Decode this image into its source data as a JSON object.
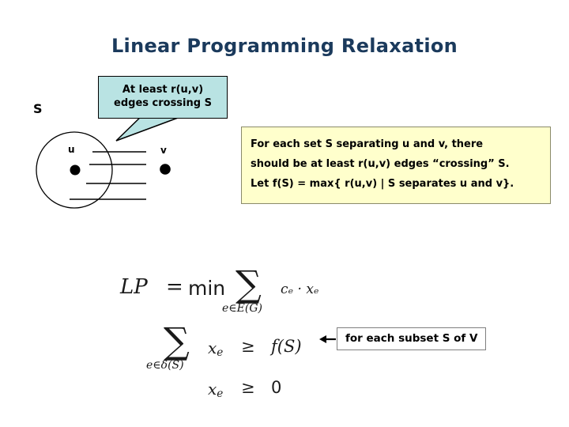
{
  "slide": {
    "title": "Linear Programming Relaxation",
    "title_color": "#1b3a5c",
    "background": "#ffffff"
  },
  "callout_cyan": {
    "fill": "#b9e3e3",
    "border": "#000000",
    "line1": "At least r(u,v)",
    "line2": "edges crossing S"
  },
  "diagram": {
    "set_label": "S",
    "vertex_u_label": "u",
    "vertex_v_label": "v",
    "crossing_edge_count": 4
  },
  "box_yellow": {
    "fill": "#ffffcc",
    "border": "#8a8a6a",
    "line1": "For each set S separating u and v, there",
    "line2": "should be at least r(u,v) edges “crossing” S.",
    "line3": "Let f(S) = max{ r(u,v) | S separates u and v}."
  },
  "lp": {
    "name": "LP",
    "equals": "=",
    "objective_op": "min",
    "sigma": "∑",
    "sum1_subscript": "e∈E(G)",
    "objective_terms": "cₑ · xₑ",
    "objective_c": "c",
    "objective_x": "x",
    "sub_e": "e",
    "dot": "·",
    "sum2_subscript": "e∈δ(S)",
    "constraint1_lhs": "x",
    "constraint1_rel": "≥",
    "constraint1_rhs": "f(S)",
    "constraint2_lhs": "x",
    "constraint2_rel": "≥",
    "constraint2_rhs": "0"
  },
  "annotation": {
    "arrow": "left-arrow-icon",
    "text": "for each subset S of V",
    "border": "#7f7f7f"
  }
}
